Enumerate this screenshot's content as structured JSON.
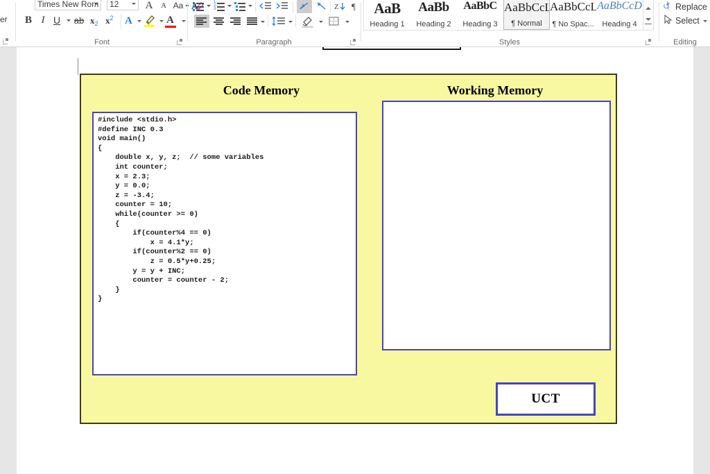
{
  "ribbon": {
    "clipboard_remnant": "er",
    "font_group": {
      "label": "Font",
      "font_name": "Times New Rom",
      "font_size": "12",
      "grow_font_icon": "A",
      "shrink_font_icon": "A",
      "change_case_icon": "Aa",
      "clear_formatting_icon": "clear-formatting-icon",
      "bold": "B",
      "italic": "I",
      "underline": "U",
      "strikethrough": "ab",
      "subscript": "x",
      "subscript_sub": "2",
      "superscript": "x",
      "superscript_sup": "2",
      "text_effects": "A",
      "highlight": "A",
      "font_color": "A",
      "highlight_color": "#ffff00",
      "font_color_value": "#ff0000",
      "text_effects_color": "#2a7fd4"
    },
    "paragraph_group": {
      "label": "Paragraph"
    },
    "styles_group": {
      "label": "Styles",
      "items": [
        {
          "preview": "AaB",
          "name": "Heading 1",
          "cls": "h1",
          "selected": false
        },
        {
          "preview": "AaBb",
          "name": "Heading 2",
          "cls": "h2",
          "selected": false
        },
        {
          "preview": "AaBbC",
          "name": "Heading 3",
          "cls": "h3",
          "selected": false
        },
        {
          "preview": "AaBbCcL",
          "name": "¶ Normal",
          "cls": "n",
          "selected": true
        },
        {
          "preview": "AaBbCcL",
          "name": "¶ No Spac...",
          "cls": "n",
          "selected": false
        },
        {
          "preview": "AaBbCcD",
          "name": "Heading 4",
          "cls": "h4",
          "selected": false
        }
      ]
    },
    "editing_group": {
      "label": "Editing",
      "replace": "Replace",
      "select": "Select",
      "select_caret": "▾"
    }
  },
  "document": {
    "clipped_shape_text": "',',',',",
    "diagram": {
      "background_color": "#f8f8a0",
      "border_color": "#3d3d18",
      "inner_border_color": "#4343c8",
      "code_memory_title": "Code Memory",
      "working_memory_title": "Working Memory",
      "uct_label": "UCT",
      "code": "#include <stdio.h>\n#define INC 0.3\nvoid main()\n{\n    double x, y, z;  // some variables\n    int counter;\n    x = 2.3;\n    y = 0.0;\n    z = -3.4;\n    counter = 10;\n    while(counter >= 0)\n    {\n        if(counter%4 == 0)\n            x = 4.1*y;\n        if(counter%2 == 0)\n            z = 0.5*y+0.25;\n        y = y + INC;\n        counter = counter - 2;\n    }\n}",
      "working_memory_content": ""
    }
  }
}
